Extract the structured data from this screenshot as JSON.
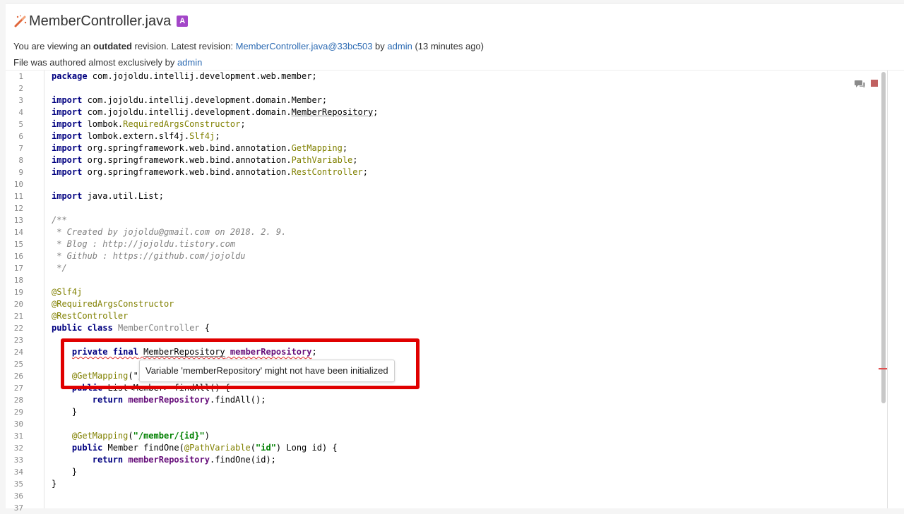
{
  "header": {
    "file_name": "MemberController.java",
    "badge": "A",
    "outdated_prefix": "You are viewing an ",
    "outdated_word": "outdated",
    "outdated_mid": " revision. Latest revision: ",
    "latest_revision_link": "MemberController.java@33bc503",
    "by_text": " by ",
    "author_link": "admin",
    "ago_text": " (13 minutes ago)",
    "authored_prefix": "File was authored almost exclusively by ",
    "authored_by_link": "admin"
  },
  "code": {
    "l1": [
      "package",
      " com.jojoldu.intellij.development.web.member;"
    ],
    "l3": [
      "import",
      " com.jojoldu.intellij.development.domain.Member;"
    ],
    "l4": [
      "import",
      " com.jojoldu.intellij.development.domain.",
      "MemberRepository",
      ";"
    ],
    "l5": [
      "import",
      " lombok.",
      "RequiredArgsConstructor",
      ";"
    ],
    "l6": [
      "import",
      " lombok.extern.slf4j.",
      "Slf4j",
      ";"
    ],
    "l7": [
      "import",
      " org.springframework.web.bind.annotation.",
      "GetMapping",
      ";"
    ],
    "l8": [
      "import",
      " org.springframework.web.bind.annotation.",
      "PathVariable",
      ";"
    ],
    "l9": [
      "import",
      " org.springframework.web.bind.annotation.",
      "RestController",
      ";"
    ],
    "l11": [
      "import",
      " java.util.List;"
    ],
    "l13": "/**",
    "l14": " * Created by jojoldu@gmail.com on 2018. 2. 9.",
    "l15": " * Blog : http://jojoldu.tistory.com",
    "l16": " * Github : https://github.com/jojoldu",
    "l17": " */",
    "l19": "@Slf4j",
    "l20": "@RequiredArgsConstructor",
    "l21": "@RestController",
    "l22": [
      "public class",
      " ",
      "MemberController",
      " {"
    ],
    "l24": [
      "    ",
      "private final",
      " ",
      "MemberRepository",
      " ",
      "memberRepository",
      ";"
    ],
    "l26": [
      "    ",
      "@GetMapping",
      "(\"/"
    ],
    "l27": [
      "    ",
      "public",
      " List<Member> findAll() {"
    ],
    "l28": [
      "        ",
      "return",
      " ",
      "memberRepository",
      ".findAll();"
    ],
    "l29": "    }",
    "l31": [
      "    ",
      "@GetMapping",
      "(",
      "\"/member/{id}\"",
      ")"
    ],
    "l32": [
      "    ",
      "public",
      " Member findOne(",
      "@PathVariable",
      "(",
      "\"id\"",
      ") Long id) {"
    ],
    "l33": [
      "        ",
      "return",
      " ",
      "memberRepository",
      ".findOne(id);"
    ],
    "l34": "    }",
    "l35": "}"
  },
  "tooltip": {
    "text": "Variable 'memberRepository' might not have been initialized"
  },
  "colors": {
    "highlight_border": "#e00000",
    "keyword": "#000080",
    "annotation": "#808000",
    "string": "#008000",
    "field": "#660e7a"
  },
  "icons": {
    "file": "wand-icon",
    "comment": "comments-icon",
    "stop": "stop-icon"
  }
}
